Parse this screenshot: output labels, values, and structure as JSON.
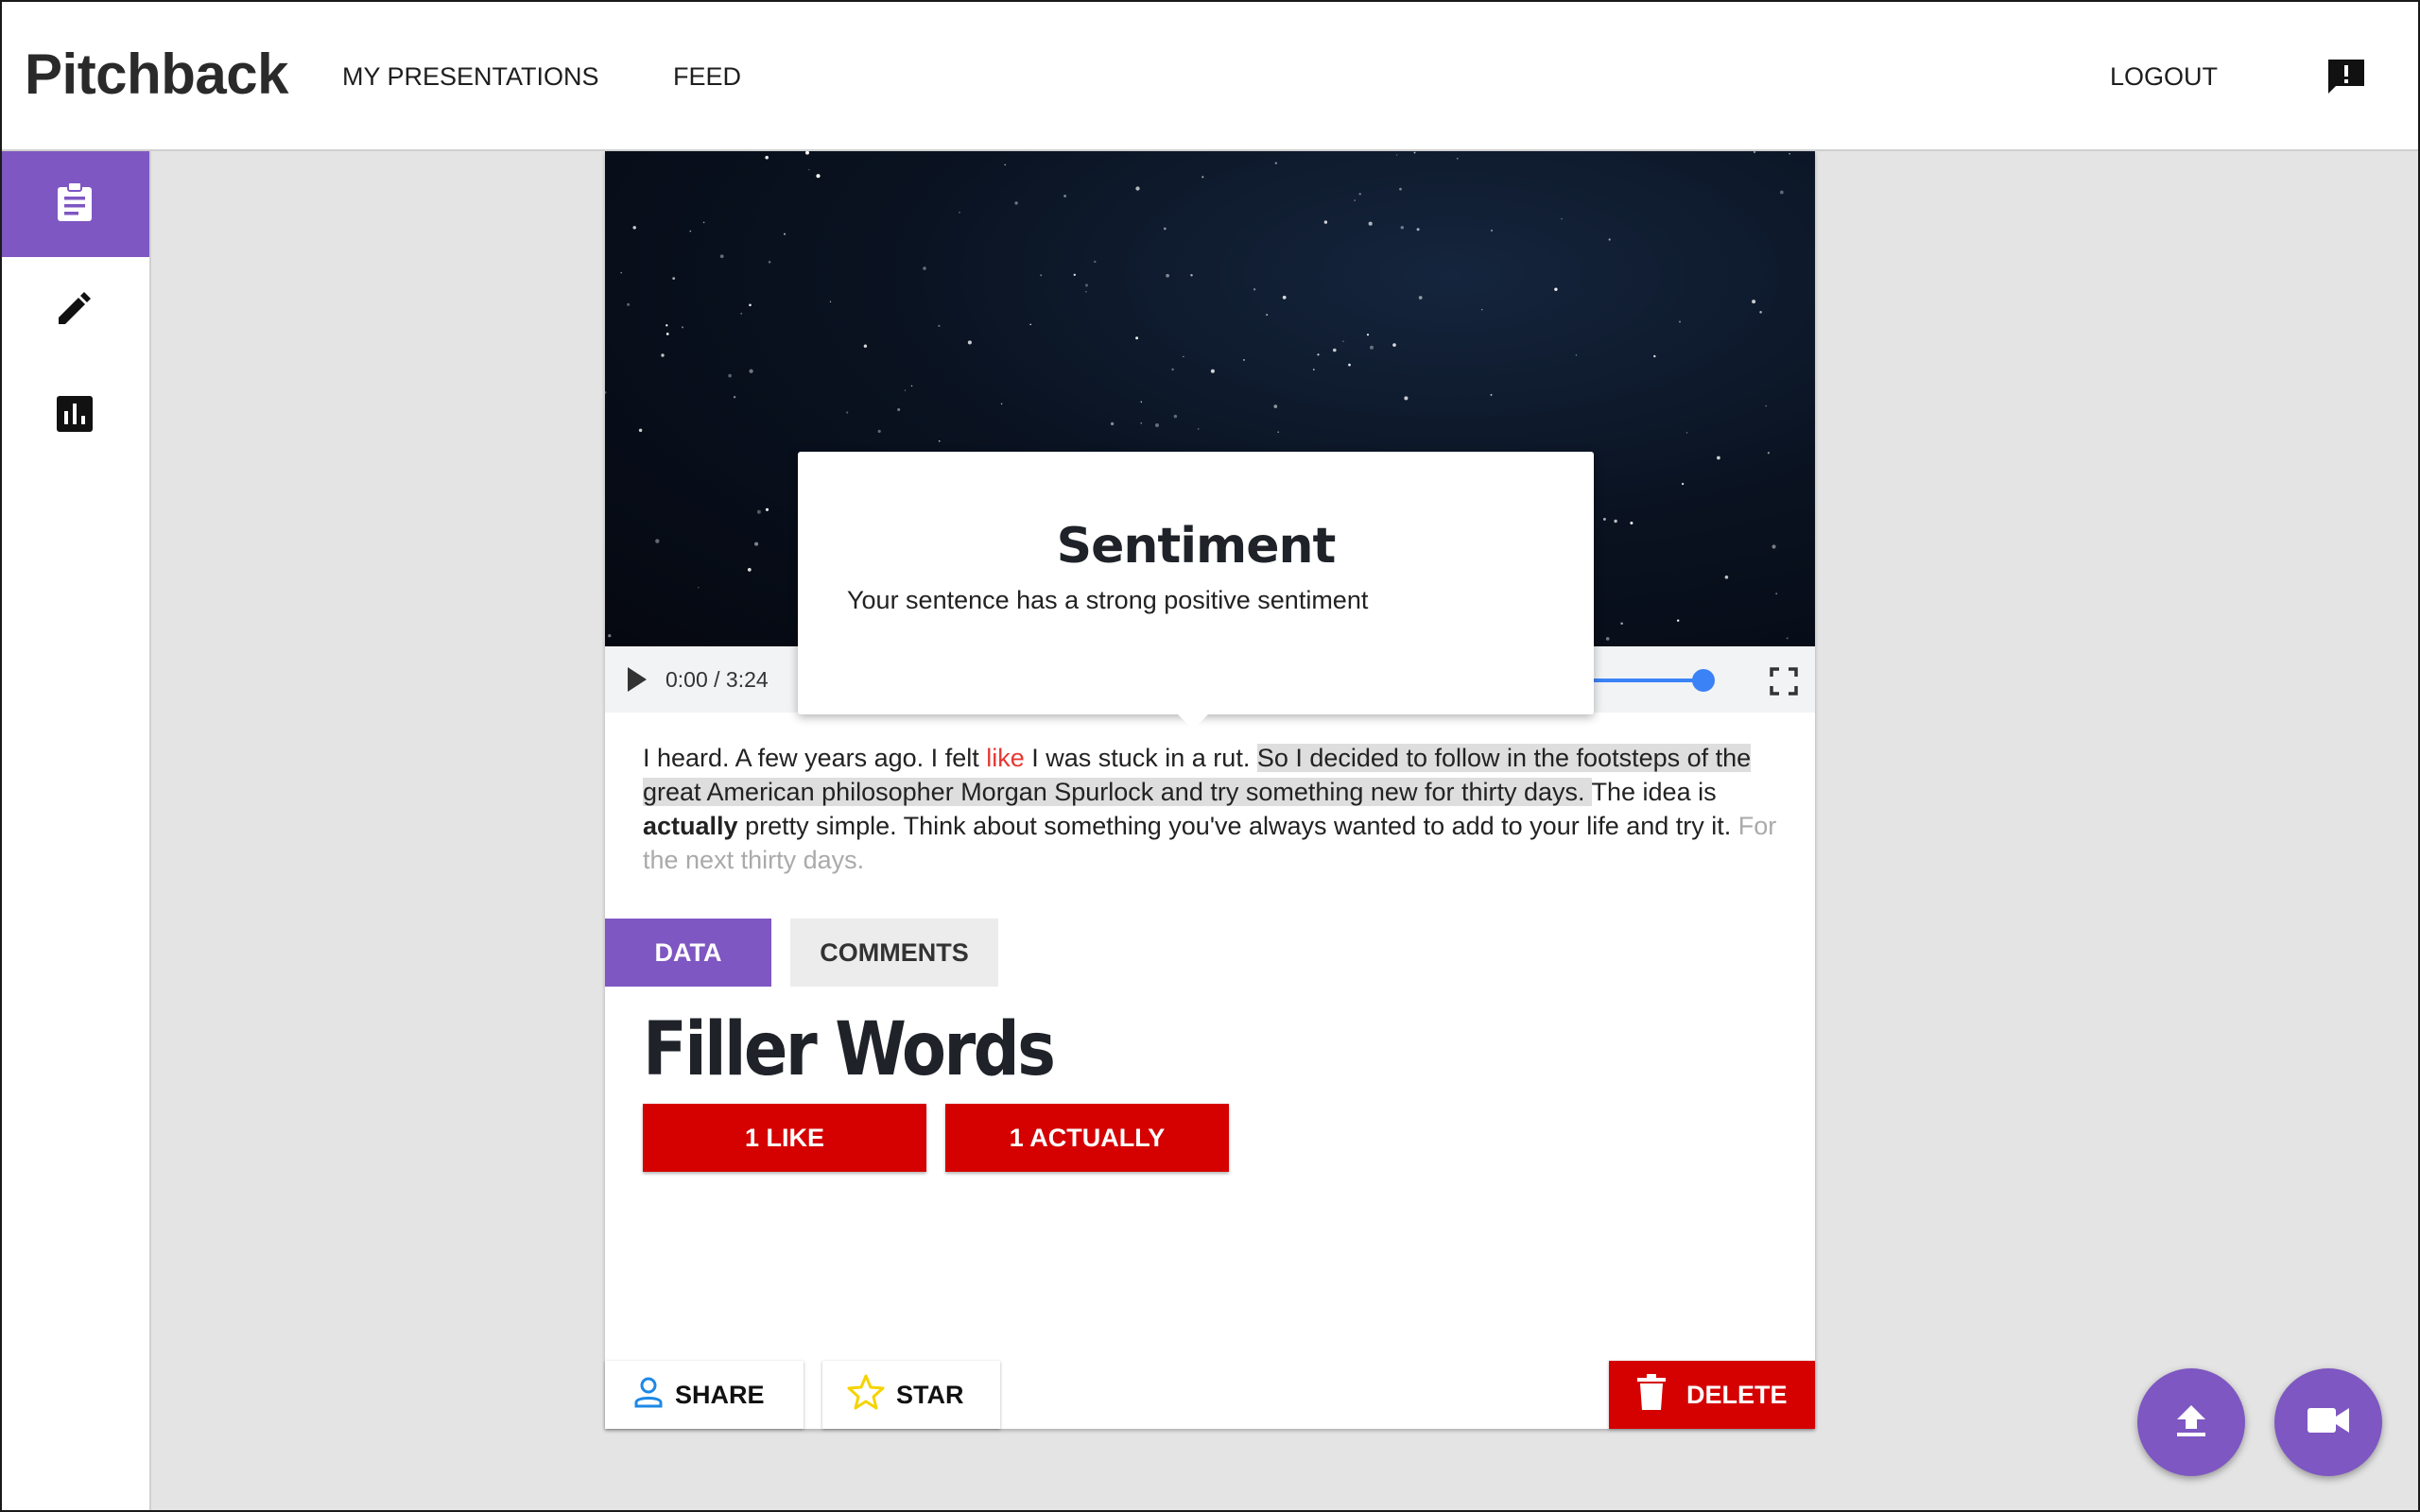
{
  "app": {
    "title": "Pitchback"
  },
  "nav": {
    "my_presentations": "MY PRESENTATIONS",
    "feed": "FEED",
    "logout": "LOGOUT"
  },
  "player": {
    "time": "0:00 / 3:24",
    "played_fraction": 0
  },
  "sentiment_popover": {
    "title": "Sentiment",
    "text": "Your sentence has a strong positive sentiment"
  },
  "transcript": {
    "seg1": "I heard. A few years ago. I felt ",
    "filler_like": "like",
    "seg2": " I was stuck in a rut. ",
    "highlighted": "So I decided to follow in the footsteps of the great American philosopher Morgan Spurlock and try something new for thirty days. ",
    "seg3": "The idea is ",
    "filler_actually": "actually",
    "seg4": " pretty simple. Think about something you've always wanted to add to your life and try it. ",
    "upcoming": "For the next thirty days."
  },
  "tabs": {
    "data": "DATA",
    "comments": "COMMENTS"
  },
  "filler_words": {
    "title": "Filler Words",
    "items": [
      "1 LIKE",
      "1 ACTUALLY"
    ]
  },
  "actions": {
    "share": "SHARE",
    "star": "STAR",
    "delete": "DELETE"
  },
  "colors": {
    "accent": "#7e57c2",
    "danger": "#d50000",
    "filler_text": "#e53935",
    "progress": "#3b82f6",
    "star": "#f5d300",
    "share_icon": "#1e88e5"
  },
  "icons": {
    "sidebar": [
      "clipboard-icon",
      "pencil-icon",
      "bar-chart-icon"
    ],
    "header": "feedback-icon",
    "fabs": [
      "upload-icon",
      "videocam-icon"
    ]
  }
}
